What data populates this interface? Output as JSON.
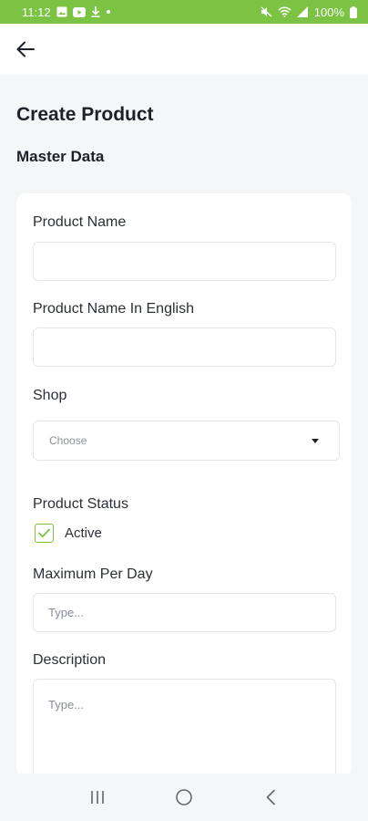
{
  "status_bar": {
    "time": "11:12",
    "battery": "100%",
    "icons_left": [
      "gallery-icon",
      "youtube-icon",
      "download-icon",
      "dot-icon"
    ],
    "icons_right": [
      "mute-icon",
      "wifi-icon",
      "signal-icon",
      "battery-icon"
    ]
  },
  "header": {
    "back_icon": "arrow-left-icon"
  },
  "page": {
    "title": "Create Product",
    "section_title": "Master Data"
  },
  "form": {
    "product_name": {
      "label": "Product Name",
      "value": "",
      "placeholder": ""
    },
    "product_name_en": {
      "label": "Product Name In English",
      "value": "",
      "placeholder": ""
    },
    "shop": {
      "label": "Shop",
      "selected": "Choose"
    },
    "status": {
      "label": "Product Status",
      "option_label": "Active",
      "checked": true
    },
    "max_per_day": {
      "label": "Maximum Per Day",
      "placeholder": "Type..."
    },
    "description": {
      "label": "Description",
      "placeholder": "Type..."
    }
  },
  "nav": {
    "icons": [
      "recent-apps-icon",
      "home-icon",
      "back-nav-icon"
    ]
  },
  "colors": {
    "accent": "#7cc243",
    "background": "#f5f6f8",
    "card": "#ffffff",
    "text": "#1d2129"
  }
}
